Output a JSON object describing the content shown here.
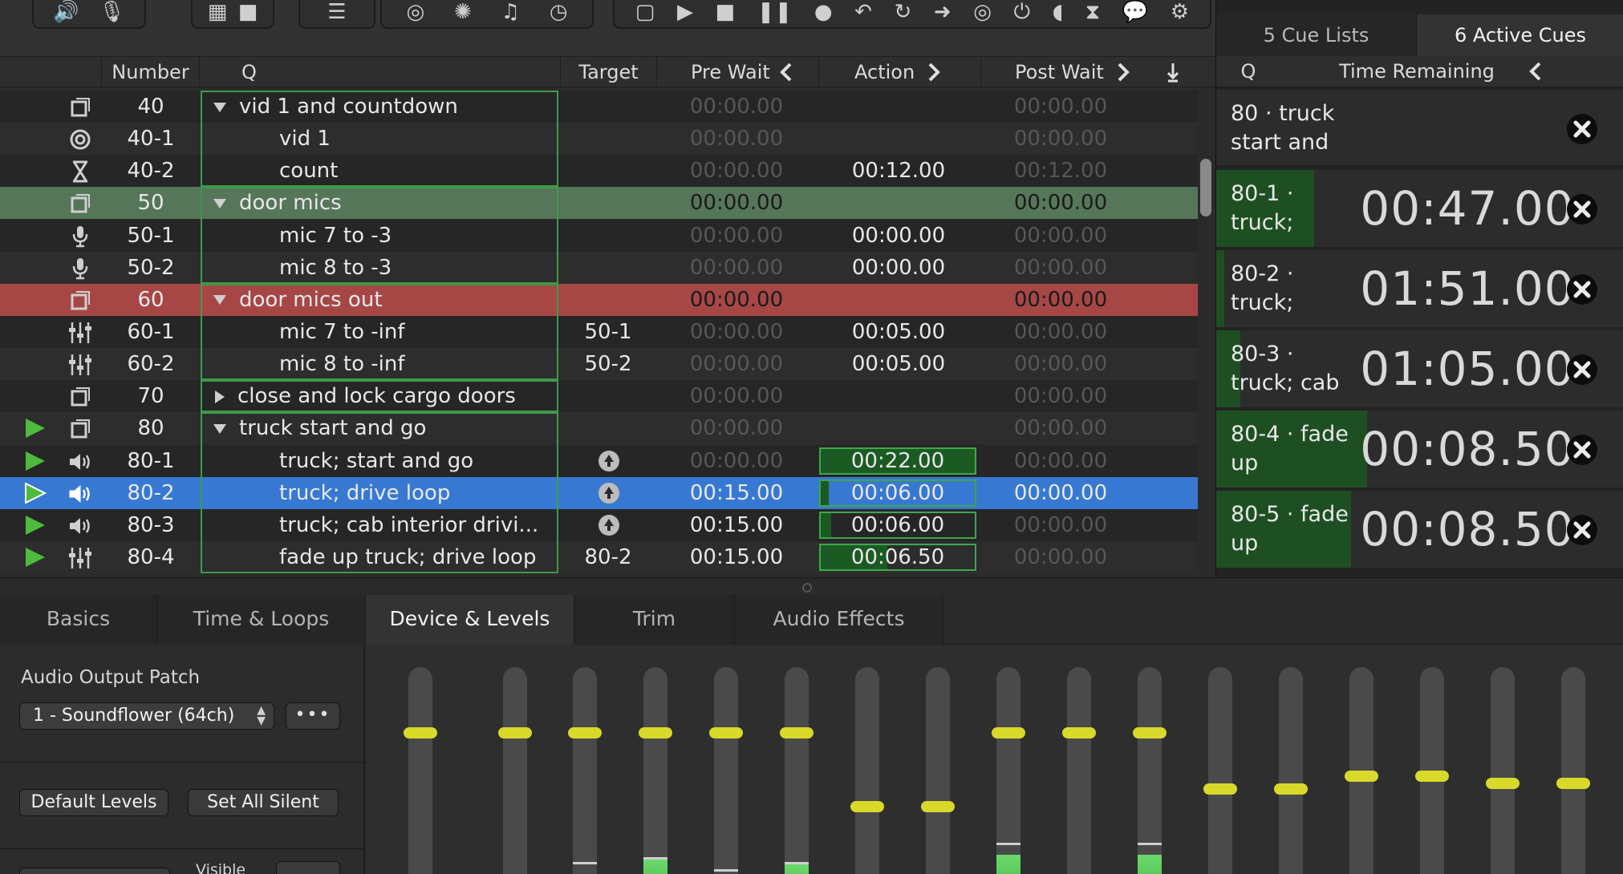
{
  "toolbar": {
    "groups": [
      {
        "icons": [
          "speaker-icon",
          "microphone-icon"
        ],
        "glyphs": [
          "🔊",
          "🎙"
        ]
      },
      {
        "icons": [
          "film-icon",
          "camera-icon"
        ],
        "glyphs": [
          "▦",
          "■"
        ]
      },
      {
        "icons": [
          "faders-icon"
        ],
        "glyphs": [
          "☰"
        ]
      },
      {
        "icons": [
          "target-icon",
          "network-icon",
          "music-note-icon",
          "clock-icon"
        ],
        "glyphs": [
          "◎",
          "✺",
          "♫",
          "◷"
        ]
      },
      {
        "icons": [
          "group-icon",
          "play-icon",
          "stop-icon",
          "pause-icon",
          "record-icon",
          "undo-icon",
          "redo-icon",
          "goto-icon",
          "target-arrow-icon",
          "power-icon",
          "wireless-icon",
          "hourglass-icon",
          "speech-icon",
          "script-icon"
        ],
        "glyphs": [
          "▢",
          "▶",
          "■",
          "❚❚",
          "●",
          "↶",
          "↻",
          "➜",
          "◎",
          "⏻",
          "◖",
          "⧗",
          "💬",
          "⚙"
        ]
      }
    ]
  },
  "table": {
    "headers": {
      "number": "Number",
      "q": "Q",
      "target": "Target",
      "pre_wait": "Pre Wait",
      "action": "Action",
      "post_wait": "Post Wait"
    },
    "rows": [
      {
        "number": "40",
        "q": "vid 1 and countdown",
        "target": "",
        "pre_wait": "00:00.00",
        "action": "",
        "post_wait": "00:00.00",
        "type_icon": "group-icon",
        "disclosure": "open",
        "level": 0,
        "style": "A",
        "pre_dim": true,
        "post_dim": true
      },
      {
        "number": "40-1",
        "q": "vid 1",
        "target": "",
        "pre_wait": "00:00.00",
        "action": "",
        "post_wait": "00:00.00",
        "type_icon": "target-icon",
        "level": 1,
        "style": "B",
        "pre_dim": true,
        "post_dim": true
      },
      {
        "number": "40-2",
        "q": "count",
        "target": "",
        "pre_wait": "00:00.00",
        "action": "00:12.00",
        "post_wait": "00:12.00",
        "type_icon": "hourglass-icon",
        "level": 1,
        "style": "A",
        "pre_dim": true,
        "post_dim": true
      },
      {
        "number": "50",
        "q": "door mics",
        "target": "",
        "pre_wait": "00:00.00",
        "action": "",
        "post_wait": "00:00.00",
        "type_icon": "group-icon",
        "disclosure": "open",
        "level": 0,
        "style": "green"
      },
      {
        "number": "50-1",
        "q": "mic 7 to -3",
        "target": "",
        "pre_wait": "00:00.00",
        "action": "00:00.00",
        "post_wait": "00:00.00",
        "type_icon": "microphone-icon",
        "level": 1,
        "style": "A",
        "pre_dim": true,
        "post_dim": true
      },
      {
        "number": "50-2",
        "q": "mic 8 to -3",
        "target": "",
        "pre_wait": "00:00.00",
        "action": "00:00.00",
        "post_wait": "00:00.00",
        "type_icon": "microphone-icon",
        "level": 1,
        "style": "B",
        "pre_dim": true,
        "post_dim": true
      },
      {
        "number": "60",
        "q": "door mics out",
        "target": "",
        "pre_wait": "00:00.00",
        "action": "",
        "post_wait": "00:00.00",
        "type_icon": "group-icon",
        "disclosure": "open",
        "level": 0,
        "style": "red"
      },
      {
        "number": "60-1",
        "q": "mic 7 to -inf",
        "target": "50-1",
        "pre_wait": "00:00.00",
        "action": "00:05.00",
        "post_wait": "00:00.00",
        "type_icon": "faders-icon",
        "level": 1,
        "style": "A",
        "pre_dim": true,
        "post_dim": true
      },
      {
        "number": "60-2",
        "q": "mic 8 to -inf",
        "target": "50-2",
        "pre_wait": "00:00.00",
        "action": "00:05.00",
        "post_wait": "00:00.00",
        "type_icon": "faders-icon",
        "level": 1,
        "style": "B",
        "pre_dim": true,
        "post_dim": true
      },
      {
        "number": "70",
        "q": "close and lock cargo doors",
        "target": "",
        "pre_wait": "00:00.00",
        "action": "",
        "post_wait": "00:00.00",
        "type_icon": "group-icon",
        "disclosure": "closed",
        "level": 0,
        "style": "A",
        "pre_dim": true,
        "post_dim": true
      },
      {
        "number": "80",
        "q": "truck start and go",
        "target": "",
        "pre_wait": "00:00.00",
        "action": "",
        "post_wait": "00:00.00",
        "type_icon": "group-icon",
        "disclosure": "open",
        "level": 0,
        "style": "B",
        "playing": true,
        "pre_dim": true,
        "post_dim": true
      },
      {
        "number": "80-1",
        "q": "truck; start and go",
        "target": "",
        "target_icon": true,
        "pre_wait": "00:00.00",
        "action": "00:22.00",
        "post_wait": "00:00.00",
        "type_icon": "speaker-icon",
        "level": 1,
        "style": "A",
        "playing": true,
        "pre_dim": true,
        "post_dim": true,
        "action_progress": 1.0
      },
      {
        "number": "80-2",
        "q": "truck; drive loop",
        "target": "",
        "target_icon": true,
        "pre_wait": "00:15.00",
        "action": "00:06.00",
        "post_wait": "00:00.00",
        "type_icon": "speaker-icon",
        "level": 1,
        "style": "selected",
        "playing": true,
        "action_progress": 0.05
      },
      {
        "number": "80-3",
        "q": "truck; cab interior drivi...",
        "target": "",
        "target_icon": true,
        "pre_wait": "00:15.00",
        "action": "00:06.00",
        "post_wait": "00:00.00",
        "type_icon": "speaker-icon",
        "level": 1,
        "style": "A",
        "playing": true,
        "post_dim": true,
        "action_progress": 0.07
      },
      {
        "number": "80-4",
        "q": "fade up truck; drive loop",
        "target": "80-2",
        "pre_wait": "00:15.00",
        "action": "00:06.50",
        "post_wait": "00:00.00",
        "type_icon": "faders-icon",
        "level": 1,
        "style": "B",
        "playing": true,
        "post_dim": true,
        "action_progress": 0.43
      }
    ]
  },
  "right_panel": {
    "tabs": [
      "5 Cue Lists",
      "6 Active Cues"
    ],
    "active_tab": 1,
    "headers": {
      "q": "Q",
      "time_remaining": "Time Remaining"
    },
    "active_cues": [
      {
        "label": "80 · truck start and",
        "time": "",
        "progress": 0.0
      },
      {
        "label": "80-1 · truck;",
        "time": "00:47.00",
        "progress": 0.24
      },
      {
        "label": "80-2 · truck;",
        "time": "01:51.00",
        "progress": 0.02
      },
      {
        "label": "80-3 · truck; cab",
        "time": "01:05.00",
        "progress": 0.06
      },
      {
        "label": "80-4 · fade up",
        "time": "00:08.50",
        "progress": 0.37
      },
      {
        "label": "80-5 · fade up",
        "time": "00:08.50",
        "progress": 0.33
      }
    ]
  },
  "inspector": {
    "tabs": [
      "Basics",
      "Time & Loops",
      "Device & Levels",
      "Trim",
      "Audio Effects"
    ],
    "active_tab": 2,
    "audio_output_patch_label": "Audio Output Patch",
    "patch_value": "1 - Soundflower (64ch)",
    "more_button": "•••",
    "default_levels": "Default Levels",
    "set_all_silent": "Set All Silent",
    "visible_label": "Visible",
    "faders": [
      {
        "level": 0.84,
        "meter": 0.0,
        "peak": null
      },
      {
        "level": 0.84,
        "meter": 0.0,
        "peak": null
      },
      {
        "level": 0.84,
        "meter": 0.12,
        "peak": 0.18
      },
      {
        "level": 0.84,
        "meter": 0.2,
        "peak": 0.2
      },
      {
        "level": 0.84,
        "meter": 0.1,
        "peak": 0.15
      },
      {
        "level": 0.84,
        "meter": 0.18,
        "peak": 0.18
      },
      {
        "level": 0.55,
        "meter": 0.03,
        "peak": 0.06
      },
      {
        "level": 0.55,
        "meter": 0.06,
        "peak": 0.08
      },
      {
        "level": 0.84,
        "meter": 0.22,
        "peak": 0.26
      },
      {
        "level": 0.84,
        "meter": 0.0,
        "peak": null
      },
      {
        "level": 0.84,
        "meter": 0.22,
        "peak": 0.26
      },
      {
        "level": 0.62,
        "meter": 0.0,
        "peak": null
      },
      {
        "level": 0.62,
        "meter": 0.02,
        "peak": 0.03
      },
      {
        "level": 0.67,
        "meter": 0.0,
        "peak": 0.04
      },
      {
        "level": 0.67,
        "meter": 0.03,
        "peak": 0.05
      },
      {
        "level": 0.64,
        "meter": 0.0,
        "peak": 0.05
      },
      {
        "level": 0.64,
        "meter": 0.03,
        "peak": 0.05
      }
    ]
  },
  "colors": {
    "accent_blue": "#3779d2",
    "group_green": "#56765a",
    "group_red": "#a64746",
    "play_green": "#4dbb3c",
    "fader_yellow": "#d9d92a"
  }
}
